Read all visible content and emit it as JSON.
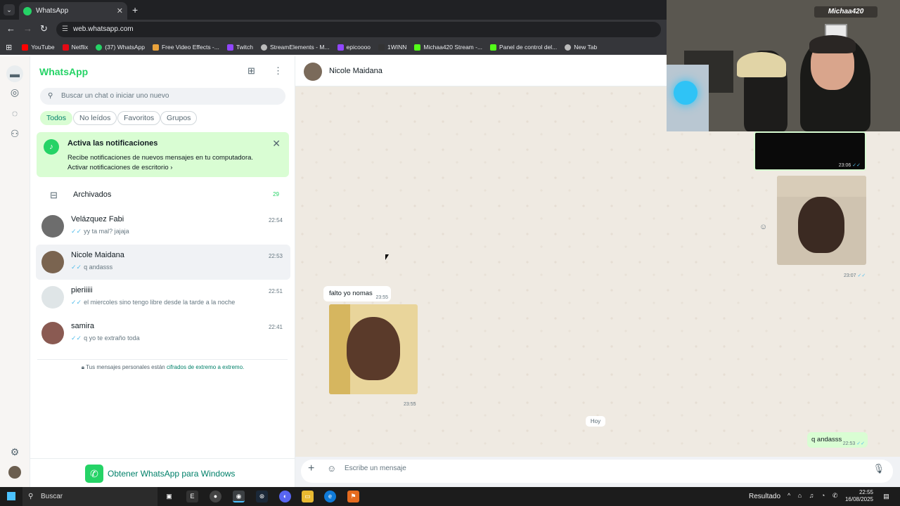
{
  "browser": {
    "tab_title": "WhatsApp",
    "url": "web.whatsapp.com",
    "bookmarks": [
      {
        "label": "YouTube",
        "color": "#ff0000"
      },
      {
        "label": "Netflix",
        "color": "#e50914"
      },
      {
        "label": "(37) WhatsApp",
        "color": "#25d366"
      },
      {
        "label": "Free Video Effects -...",
        "color": "#e9a23b"
      },
      {
        "label": "Twitch",
        "color": "#9146ff"
      },
      {
        "label": "StreamElements - M...",
        "color": "#bbbbbb"
      },
      {
        "label": "epicoooo",
        "color": "#9146ff"
      },
      {
        "label": "1WINN",
        "color": "#333333"
      },
      {
        "label": "Michaa420 Stream -...",
        "color": "#53fc18"
      },
      {
        "label": "Panel de control del...",
        "color": "#53fc18"
      },
      {
        "label": "New Tab",
        "color": "#bbbbbb"
      }
    ]
  },
  "whatsapp": {
    "brand": "WhatsApp",
    "search_placeholder": "Buscar un chat o iniciar uno nuevo",
    "filters": [
      "Todos",
      "No leídos",
      "Favoritos",
      "Grupos"
    ],
    "notification": {
      "title": "Activa las notificaciones",
      "body": "Recibe notificaciones de nuevos mensajes en tu computadora.",
      "link": "Activar notificaciones de escritorio"
    },
    "archived": {
      "label": "Archivados",
      "count": "29"
    },
    "chats": [
      {
        "name": "Velázquez Fabi",
        "time": "22:54",
        "preview": "yy ta mal? jajaja"
      },
      {
        "name": "Nicole Maidana",
        "time": "22:53",
        "preview": "q andasss"
      },
      {
        "name": "pieriiiii",
        "time": "22:51",
        "preview": "el miercoles sino tengo libre desde la tarde a la noche"
      },
      {
        "name": "samira",
        "time": "22:41",
        "preview": "q yo te extraño toda"
      }
    ],
    "encryption": {
      "text": "Tus mensajes personales están ",
      "link": "cifrados de extremo a extremo."
    },
    "get_app": "Obtener WhatsApp para Windows",
    "conversation": {
      "contact": "Nicole Maidana",
      "messages": [
        {
          "text": "",
          "time": "23:06"
        },
        {
          "text": "",
          "time": "23:07"
        },
        {
          "text": "falto yo nomas",
          "time": "23:55"
        },
        {
          "text": "",
          "time": "23:55"
        },
        {
          "text": "q andasss",
          "time": "22:53"
        }
      ],
      "date_separator": "Hoy",
      "composer_placeholder": "Escribe un mensaje"
    }
  },
  "stream_overlay": {
    "tag": "Michaa420"
  },
  "taskbar": {
    "search": "Buscar",
    "result_label": "Resultado",
    "time": "22:55",
    "date": "16/08/2025"
  }
}
